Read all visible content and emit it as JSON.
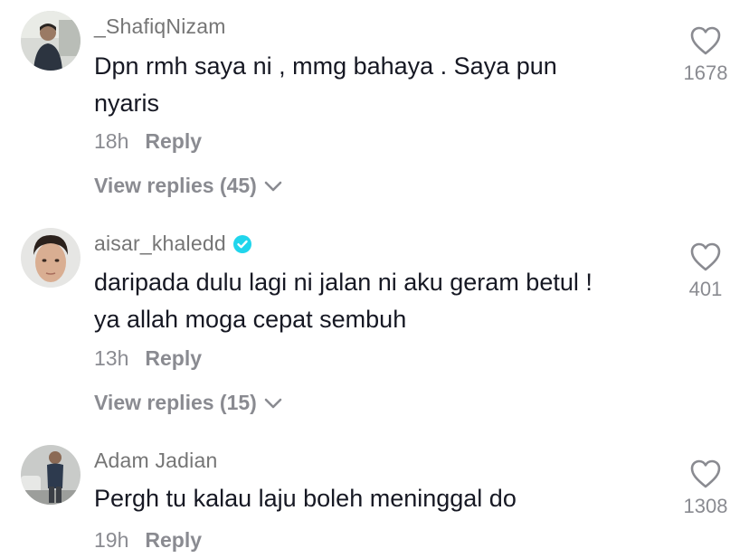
{
  "colors": {
    "username": "#757575",
    "text": "#161823",
    "secondary": "#8a8b91",
    "verified": "#20d5ec"
  },
  "icons": {
    "like": "heart-outline-icon",
    "expand": "chevron-down-icon",
    "verified": "verified-badge-icon"
  },
  "comments": [
    {
      "username": "_ShafiqNizam",
      "verified": false,
      "text": "Dpn rmh saya ni , mmg bahaya . Saya pun\nnyaris",
      "time": "18h",
      "reply_label": "Reply",
      "view_replies": "View replies (45)",
      "likes": "1678"
    },
    {
      "username": "aisar_khaledd",
      "verified": true,
      "text": "daripada dulu lagi ni jalan ni aku geram betul !\nya allah moga cepat sembuh",
      "time": "13h",
      "reply_label": "Reply",
      "view_replies": "View replies (15)",
      "likes": "401"
    },
    {
      "username": "Adam Jadian",
      "verified": false,
      "text": "Pergh tu kalau laju boleh meninggal do",
      "time": "19h",
      "reply_label": "Reply",
      "likes": "1308"
    }
  ]
}
